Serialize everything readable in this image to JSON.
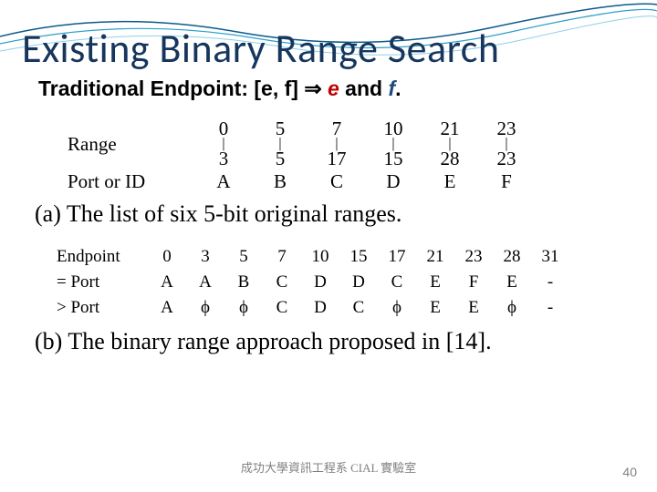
{
  "title": "Existing Binary Range Search",
  "subtitle": {
    "prefix": "Traditional Endpoint: [e, f] ",
    "arrow": "⇒",
    "gap": " ",
    "e": "e",
    "and": " and ",
    "f": "f",
    "dot": "."
  },
  "figA": {
    "rangeLabel": "Range",
    "portLabel": "Port or ID",
    "top": [
      "0",
      "5",
      "7",
      "10",
      "21",
      "23"
    ],
    "bottom": [
      "3",
      "5",
      "17",
      "15",
      "28",
      "23"
    ],
    "ports": [
      "A",
      "B",
      "C",
      "D",
      "E",
      "F"
    ]
  },
  "captionA": "(a) The list of six 5-bit original ranges.",
  "figB": {
    "endpointLabel": "Endpoint",
    "eqLabel": "= Port",
    "gtLabel": "> Port",
    "endpoints": [
      "0",
      "3",
      "5",
      "7",
      "10",
      "15",
      "17",
      "21",
      "23",
      "28",
      "31"
    ],
    "eqPorts": [
      "A",
      "A",
      "B",
      "C",
      "D",
      "D",
      "C",
      "E",
      "F",
      "E",
      "-"
    ],
    "gtPorts": [
      "A",
      "ϕ",
      "ϕ",
      "C",
      "D",
      "C",
      "ϕ",
      "E",
      "E",
      "ϕ",
      "-"
    ]
  },
  "captionB": "(b) The binary range approach proposed in [14].",
  "footer": "成功大學資訊工程系   CIAL 實驗室",
  "pageNum": "40",
  "chart_data": [
    {
      "type": "table",
      "title": "(a) The list of six 5-bit original ranges.",
      "categories": [
        "A",
        "B",
        "C",
        "D",
        "E",
        "F"
      ],
      "series": [
        {
          "name": "range_low",
          "values": [
            0,
            5,
            7,
            10,
            21,
            23
          ]
        },
        {
          "name": "range_high",
          "values": [
            3,
            5,
            17,
            15,
            28,
            23
          ]
        }
      ]
    },
    {
      "type": "table",
      "title": "(b) The binary range approach proposed in [14].",
      "x": [
        0,
        3,
        5,
        7,
        10,
        15,
        17,
        21,
        23,
        28,
        31
      ],
      "series": [
        {
          "name": "= Port",
          "values": [
            "A",
            "A",
            "B",
            "C",
            "D",
            "D",
            "C",
            "E",
            "F",
            "E",
            "-"
          ]
        },
        {
          "name": "> Port",
          "values": [
            "A",
            "ϕ",
            "ϕ",
            "C",
            "D",
            "C",
            "ϕ",
            "E",
            "E",
            "ϕ",
            "-"
          ]
        }
      ]
    }
  ]
}
